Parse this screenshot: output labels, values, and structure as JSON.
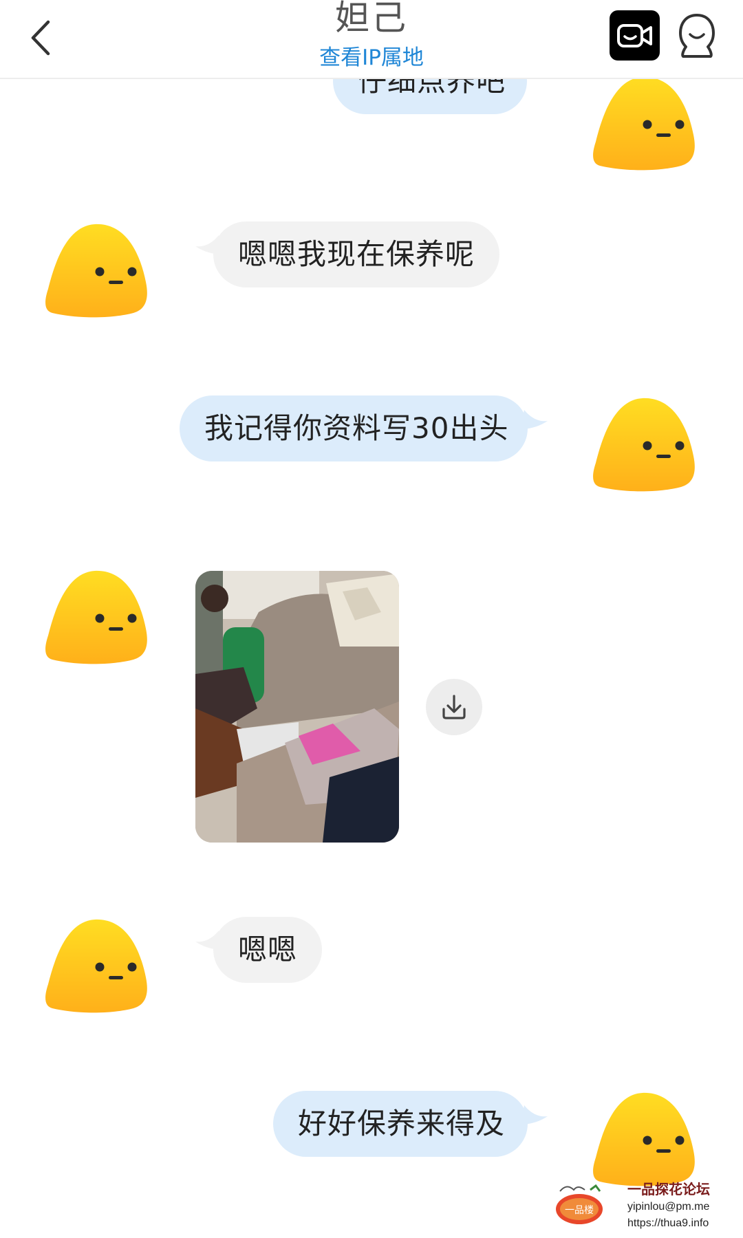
{
  "header": {
    "title": "妲己",
    "subtitle": "查看IP属地",
    "icons": {
      "back": "chevron-left-icon",
      "video": "video-camera-icon",
      "profile": "profile-icon"
    }
  },
  "messages": [
    {
      "direction": "out",
      "type": "text",
      "text": "仔细点养吧"
    },
    {
      "direction": "in",
      "type": "text",
      "text": "嗯嗯我现在保养呢"
    },
    {
      "direction": "out",
      "type": "text",
      "text": "我记得你资料写30出头"
    },
    {
      "direction": "in",
      "type": "image",
      "action_icon": "download-icon"
    },
    {
      "direction": "in",
      "type": "text",
      "text": "嗯嗯"
    },
    {
      "direction": "out",
      "type": "text",
      "text": "好好保养来得及"
    }
  ],
  "watermark": {
    "logo_text": "一品楼",
    "line1": "一品探花论坛",
    "line2": "yipinlou@pm.me",
    "line3": "https://thua9.info"
  },
  "colors": {
    "incoming_bubble": "#f2f2f2",
    "outgoing_bubble": "#dcecfb",
    "accent_blue": "#1f86d6",
    "avatar_yellow": "#ffd21f",
    "avatar_orange": "#ffb21a"
  }
}
